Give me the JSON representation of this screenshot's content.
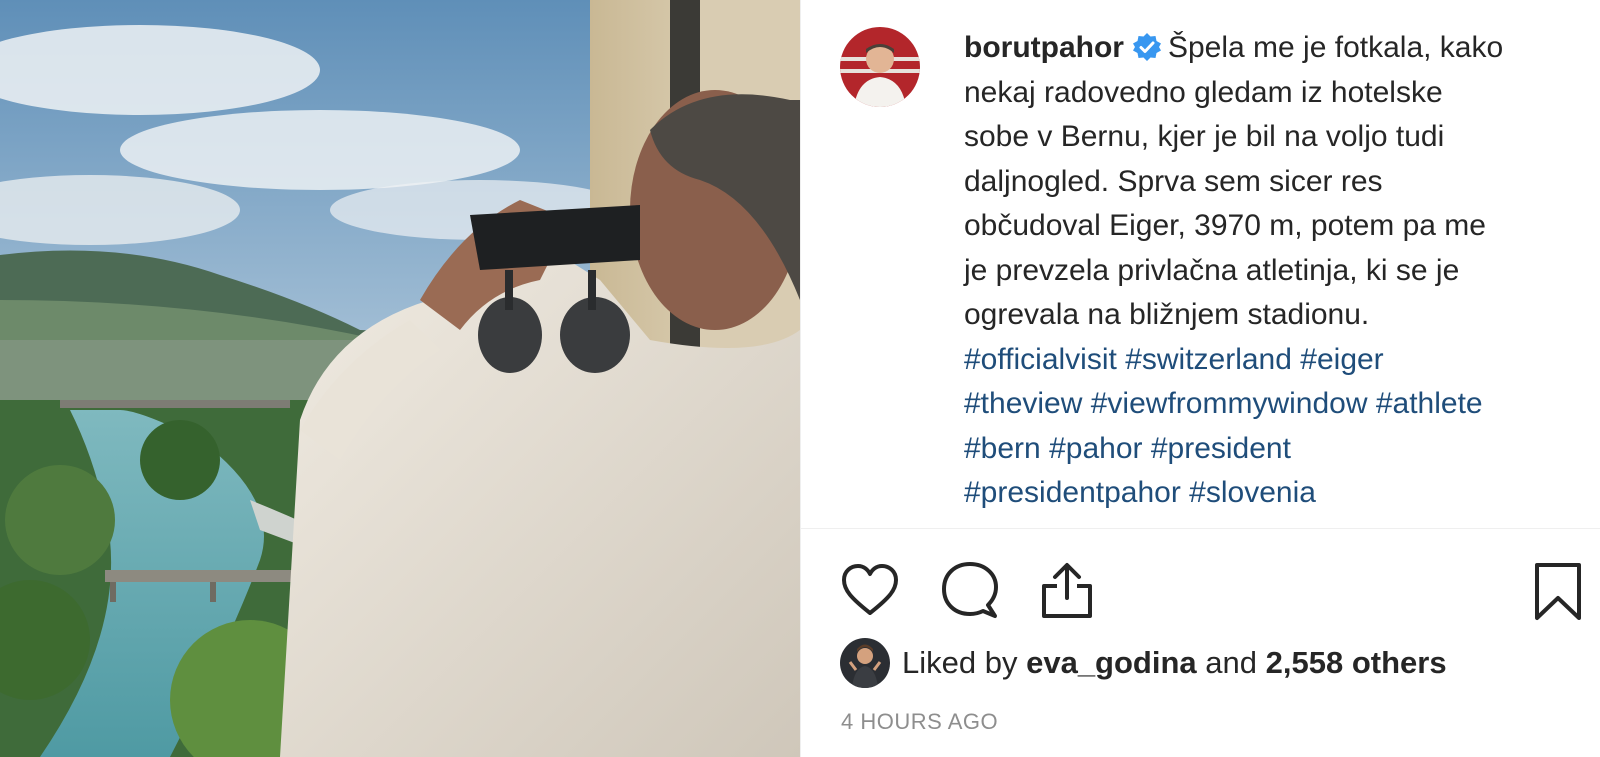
{
  "post": {
    "username": "borutpahor",
    "caption_lines": [
      "Špela me je fotkala, kako",
      "nekaj radovedno gledam iz hotelske",
      "sobe v Bernu, kjer je bil na voljo tudi",
      "daljnogled. Sprva sem sicer res",
      "občudoval Eiger, 3970 m, potem pa me",
      "je prevzela privlačna atletinja, ki se je",
      "ogrevala na bližnjem stadionu."
    ],
    "hashtag_lines": [
      [
        "#officialvisit",
        "#switzerland",
        "#eiger"
      ],
      [
        "#theview",
        "#viewfrommywindow",
        "#athlete"
      ],
      [
        "#bern",
        "#pahor",
        "#president"
      ],
      [
        "#presidentpahor",
        "#slovenia"
      ]
    ],
    "liked_by_prefix": "Liked by",
    "liked_by_user": "eva_godina",
    "liked_by_and": "and",
    "liked_by_others": "2,558 others",
    "timestamp": "4 HOURS AGO"
  },
  "icons": {
    "like": "heart-icon",
    "comment": "comment-icon",
    "share": "share-icon",
    "save": "bookmark-icon",
    "verified": "verified-badge-icon"
  },
  "colors": {
    "text": "#262626",
    "hashtag": "#1f4d7a",
    "muted": "#8e8e8e",
    "verified": "#3897f0"
  }
}
